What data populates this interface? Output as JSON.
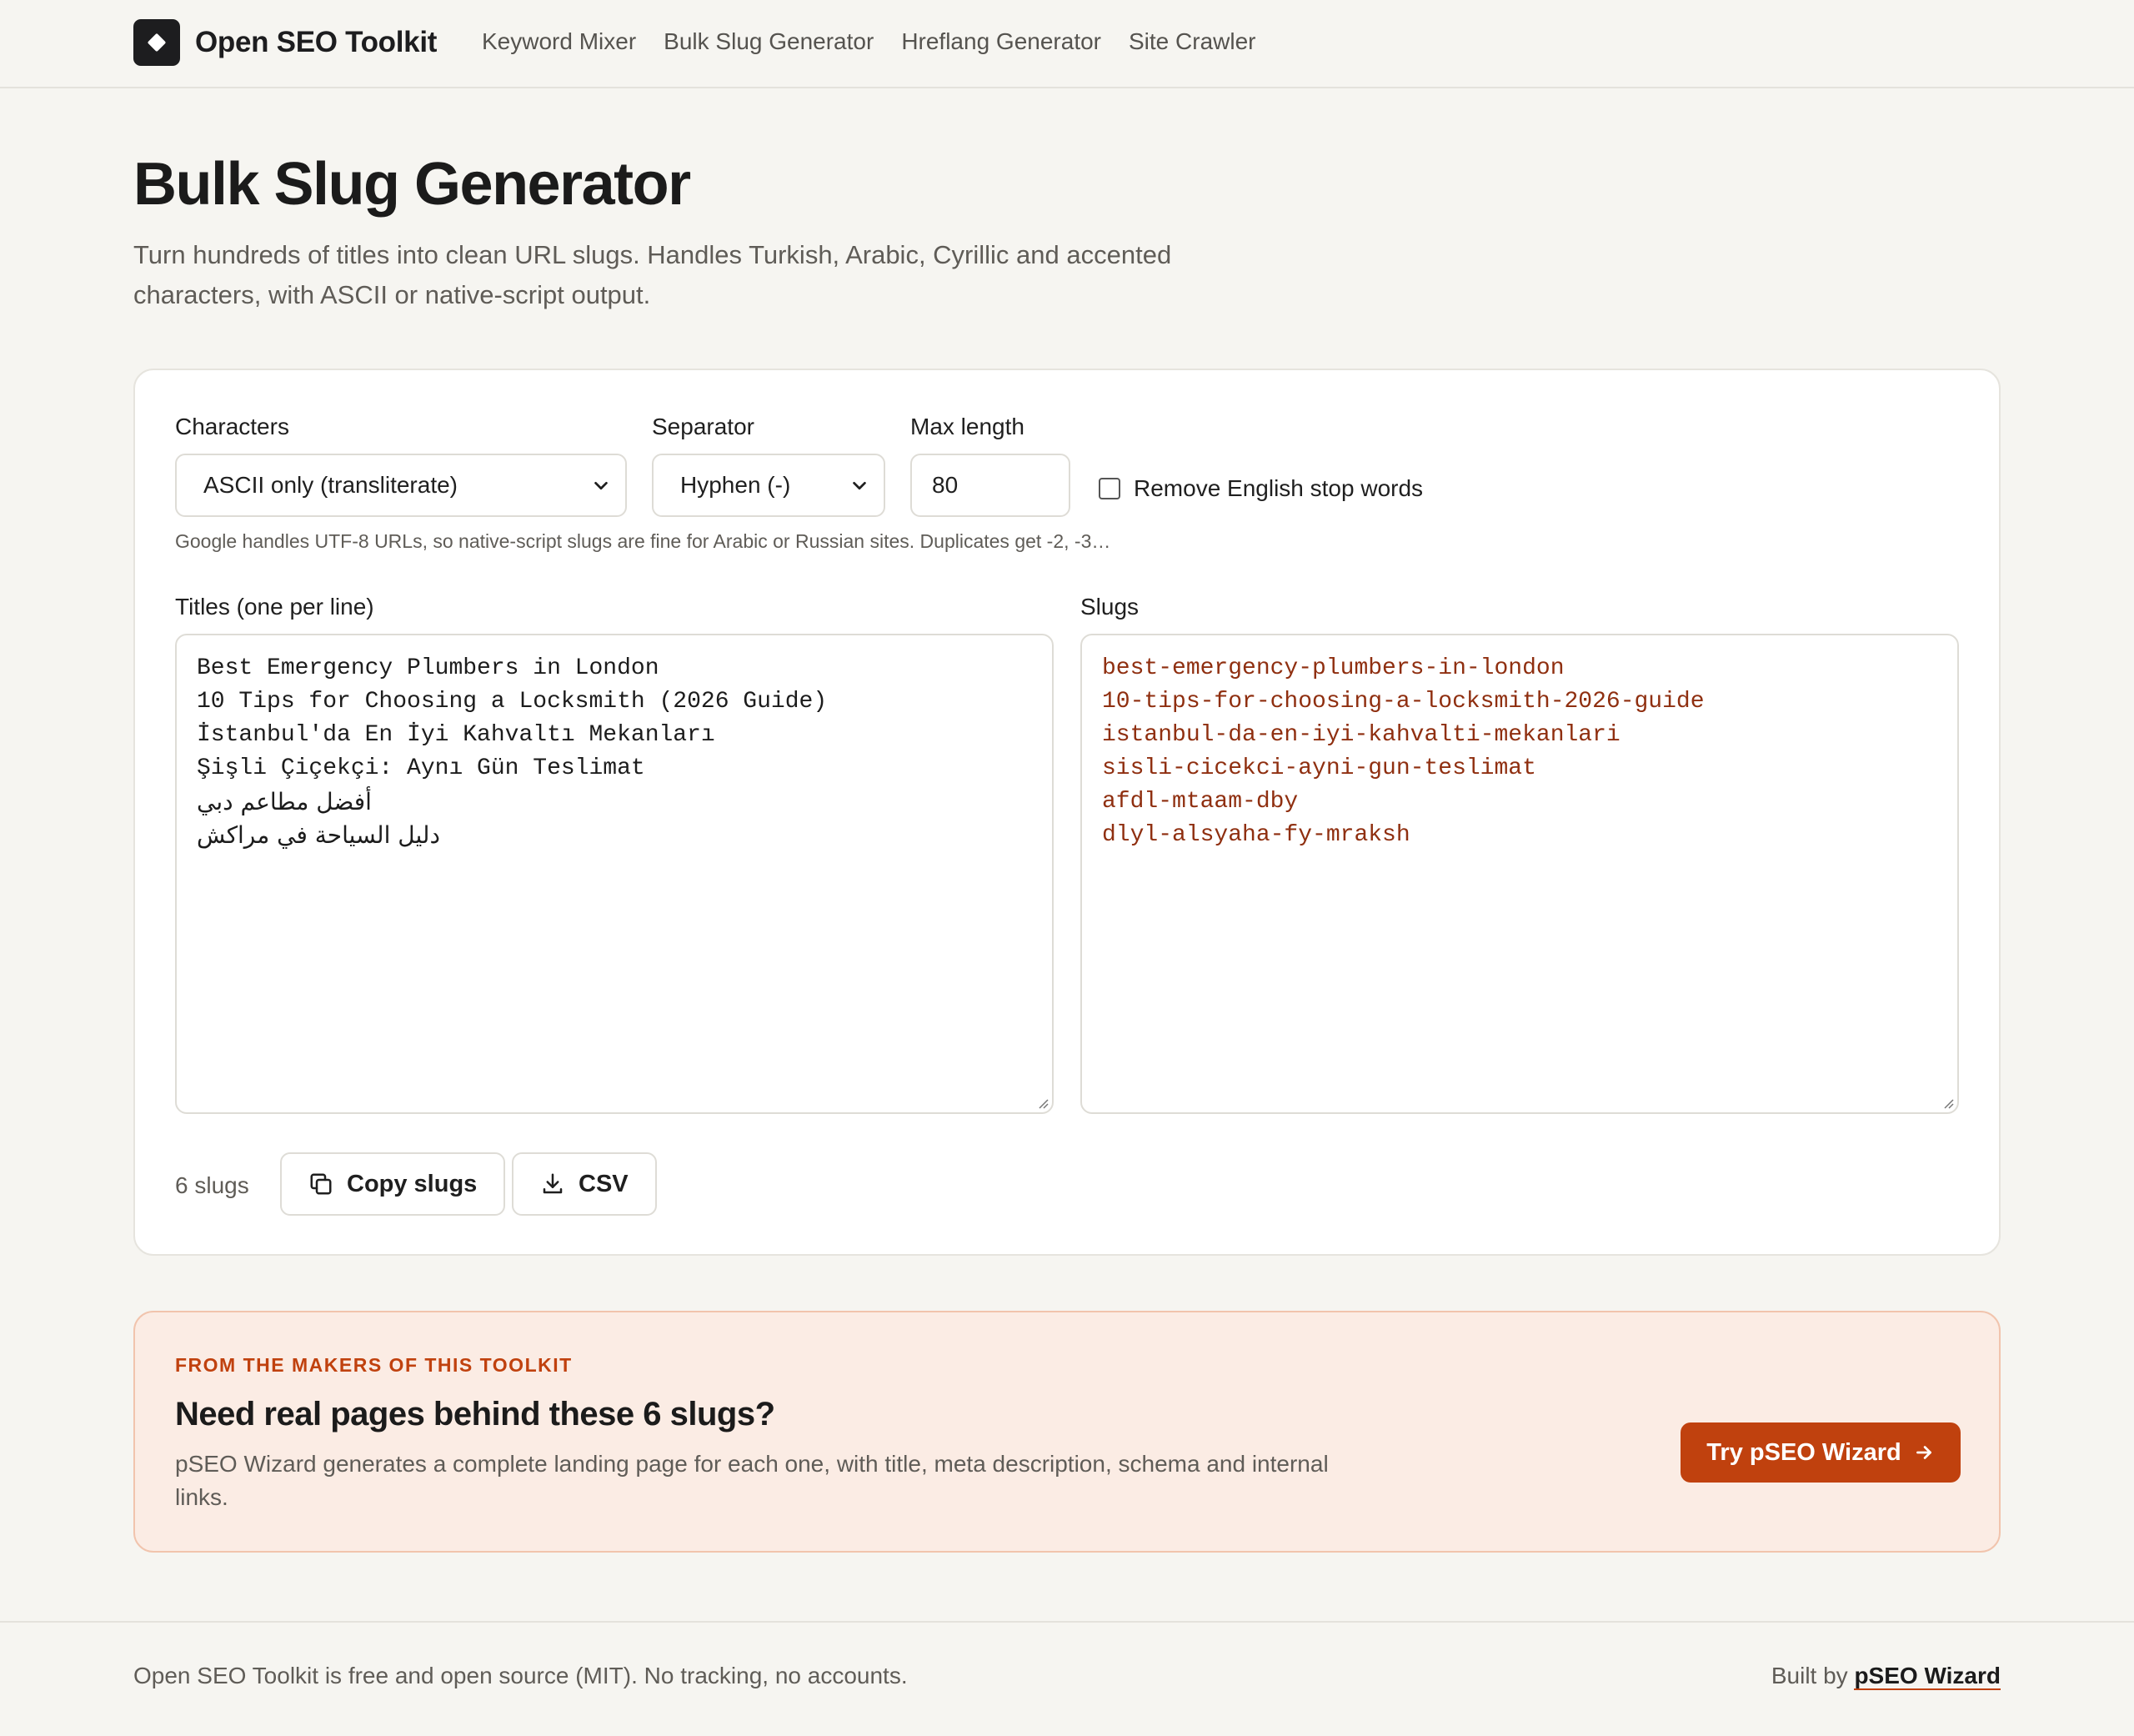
{
  "header": {
    "brand": "Open SEO Toolkit",
    "nav": [
      "Keyword Mixer",
      "Bulk Slug Generator",
      "Hreflang Generator",
      "Site Crawler"
    ]
  },
  "page": {
    "title": "Bulk Slug Generator",
    "description": "Turn hundreds of titles into clean URL slugs. Handles Turkish, Arabic, Cyrillic and accented characters, with ASCII or native-script output."
  },
  "options": {
    "characters_label": "Characters",
    "characters_value": "ASCII only (transliterate)",
    "separator_label": "Separator",
    "separator_value": "Hyphen (-)",
    "max_length_label": "Max length",
    "max_length_value": "80",
    "stopwords_label": "Remove English stop words",
    "stopwords_checked": false,
    "hint": "Google handles UTF-8 URLs, so native-script slugs are fine for Arabic or Russian sites. Duplicates get -2, -3…"
  },
  "titles": {
    "label": "Titles (one per line)",
    "lines": [
      "Best Emergency Plumbers in London",
      "10 Tips for Choosing a Locksmith (2026 Guide)",
      "İstanbul'da En İyi Kahvaltı Mekanları",
      "Şişli Çiçekçi: Aynı Gün Teslimat",
      "أفضل مطاعم دبي",
      "دليل السياحة في مراكش"
    ]
  },
  "slugs": {
    "label": "Slugs",
    "lines": [
      "best-emergency-plumbers-in-london",
      "10-tips-for-choosing-a-locksmith-2026-guide",
      "istanbul-da-en-iyi-kahvalti-mekanlari",
      "sisli-cicekci-ayni-gun-teslimat",
      "afdl-mtaam-dby",
      "dlyl-alsyaha-fy-mraksh"
    ]
  },
  "actions": {
    "count": "6 slugs",
    "copy_label": "Copy slugs",
    "csv_label": "CSV"
  },
  "promo": {
    "eyebrow": "FROM THE MAKERS OF THIS TOOLKIT",
    "title": "Need real pages behind these 6 slugs?",
    "description": "pSEO Wizard generates a complete landing page for each one, with title, meta description, schema and internal links.",
    "button": "Try pSEO Wizard"
  },
  "footer": {
    "left": "Open SEO Toolkit is free and open source (MIT). No tracking, no accounts.",
    "right_prefix": "Built by",
    "right_link": "pSEO Wizard"
  },
  "colors": {
    "accent": "#c0410e",
    "slug_text": "#8f2f10",
    "background": "#f6f5f1",
    "promo_bg": "#fbece4"
  },
  "icons": {
    "logo": "diamond-logo-icon",
    "copy": "copy-icon",
    "download": "download-icon",
    "arrow": "arrow-right-icon",
    "select": "chevron-down-icon"
  }
}
